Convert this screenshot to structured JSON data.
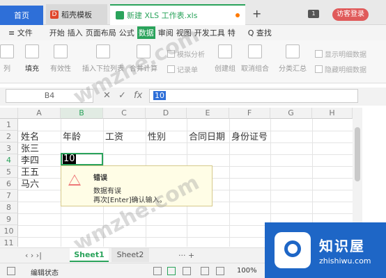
{
  "tabs": {
    "home": "首页",
    "docer": "稻壳模板",
    "sheet": "新建 XLS 工作表.xls",
    "plus": "+",
    "badge": "1",
    "login": "访客登录"
  },
  "menu": {
    "file": "≡ 文件",
    "items": [
      "开始",
      "插入",
      "页面布局",
      "公式",
      "数据",
      "审阅",
      "视图",
      "开发工具",
      "特"
    ],
    "search": "Q 查找",
    "active_index": 4
  },
  "ribbon": {
    "items": [
      "列",
      "填充",
      "有效性",
      "插入下拉列表",
      "合并计算",
      "记录单",
      "创建组",
      "取消组合",
      "分类汇总"
    ],
    "small": [
      "模拟分析",
      "显示明细数据",
      "隐藏明细数据"
    ]
  },
  "formula": {
    "namebox": "B4",
    "cancel": "✕",
    "confirm": "✓",
    "fx": "fx",
    "value": "10"
  },
  "grid": {
    "columns": [
      "A",
      "B",
      "C",
      "D",
      "E",
      "F",
      "G",
      "H"
    ],
    "rows": [
      "1",
      "2",
      "3",
      "4",
      "5",
      "6",
      "7",
      "8",
      "9",
      "10",
      "11"
    ],
    "selected_column": "B",
    "selected_row": "4",
    "headers_row2": [
      "姓名",
      "年龄",
      "工资",
      "性别",
      "合同日期",
      "身份证号"
    ],
    "colA": {
      "r3": "张三",
      "r4": "李四",
      "r5": "王五",
      "r6": "马六"
    },
    "active_value": "10"
  },
  "tooltip": {
    "title": "错误",
    "line1": "数据有误",
    "line2": "再次[Enter]确认输入。"
  },
  "sheets": {
    "nav": "‹  ›  ›|",
    "active": "Sheet1",
    "other": "Sheet2",
    "more": "···  +"
  },
  "status": {
    "text": "编辑状态",
    "zoom": "100%"
  },
  "logo": {
    "title": "知识屋",
    "sub": "zhishiwu.com"
  },
  "watermark": "wmzhe.com",
  "colors": {
    "accent_green": "#2aa35b",
    "tab_blue": "#2e6fd8",
    "error_red": "#e77777"
  }
}
